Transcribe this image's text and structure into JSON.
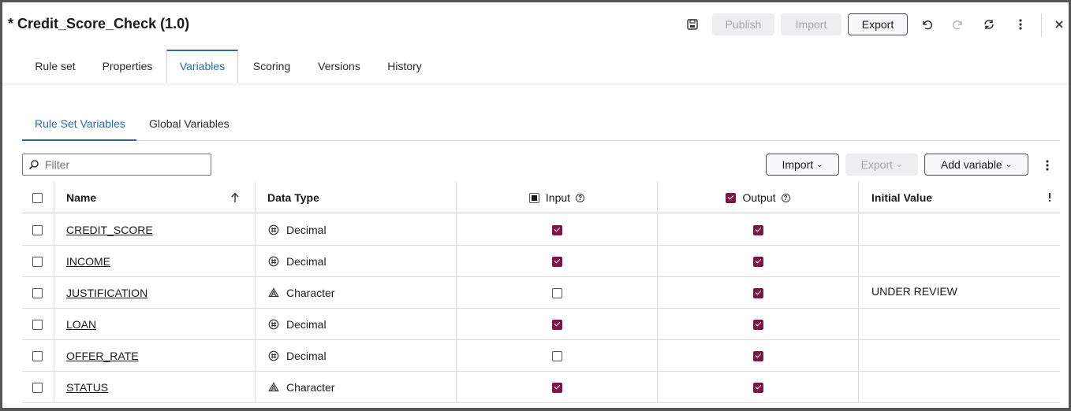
{
  "header": {
    "title": "* Credit_Score_Check (1.0)",
    "publish_label": "Publish",
    "import_label": "Import",
    "export_label": "Export"
  },
  "tabs": [
    {
      "label": "Rule set"
    },
    {
      "label": "Properties"
    },
    {
      "label": "Variables",
      "active": true
    },
    {
      "label": "Scoring"
    },
    {
      "label": "Versions"
    },
    {
      "label": "History"
    }
  ],
  "subtabs": [
    {
      "label": "Rule Set Variables",
      "active": true
    },
    {
      "label": "Global Variables"
    }
  ],
  "toolbar": {
    "filter_placeholder": "Filter",
    "import_label": "Import",
    "export_label": "Export",
    "add_variable_label": "Add variable"
  },
  "table": {
    "columns": {
      "name": "Name",
      "data_type": "Data Type",
      "input": "Input",
      "output": "Output",
      "initial_value": "Initial Value"
    },
    "rows": [
      {
        "name": "CREDIT_SCORE",
        "data_type": "Decimal",
        "type_icon": "decimal",
        "input": true,
        "output": true,
        "initial_value": ""
      },
      {
        "name": "INCOME",
        "data_type": "Decimal",
        "type_icon": "decimal",
        "input": true,
        "output": true,
        "initial_value": ""
      },
      {
        "name": "JUSTIFICATION",
        "data_type": "Character",
        "type_icon": "character",
        "input": false,
        "output": true,
        "initial_value": "UNDER REVIEW"
      },
      {
        "name": "LOAN",
        "data_type": "Decimal",
        "type_icon": "decimal",
        "input": true,
        "output": true,
        "initial_value": ""
      },
      {
        "name": "OFFER_RATE",
        "data_type": "Decimal",
        "type_icon": "decimal",
        "input": false,
        "output": true,
        "initial_value": ""
      },
      {
        "name": "STATUS",
        "data_type": "Character",
        "type_icon": "character",
        "input": true,
        "output": true,
        "initial_value": ""
      }
    ]
  },
  "colors": {
    "accent": "#2d6aa8",
    "checkbox": "#7d1548"
  }
}
